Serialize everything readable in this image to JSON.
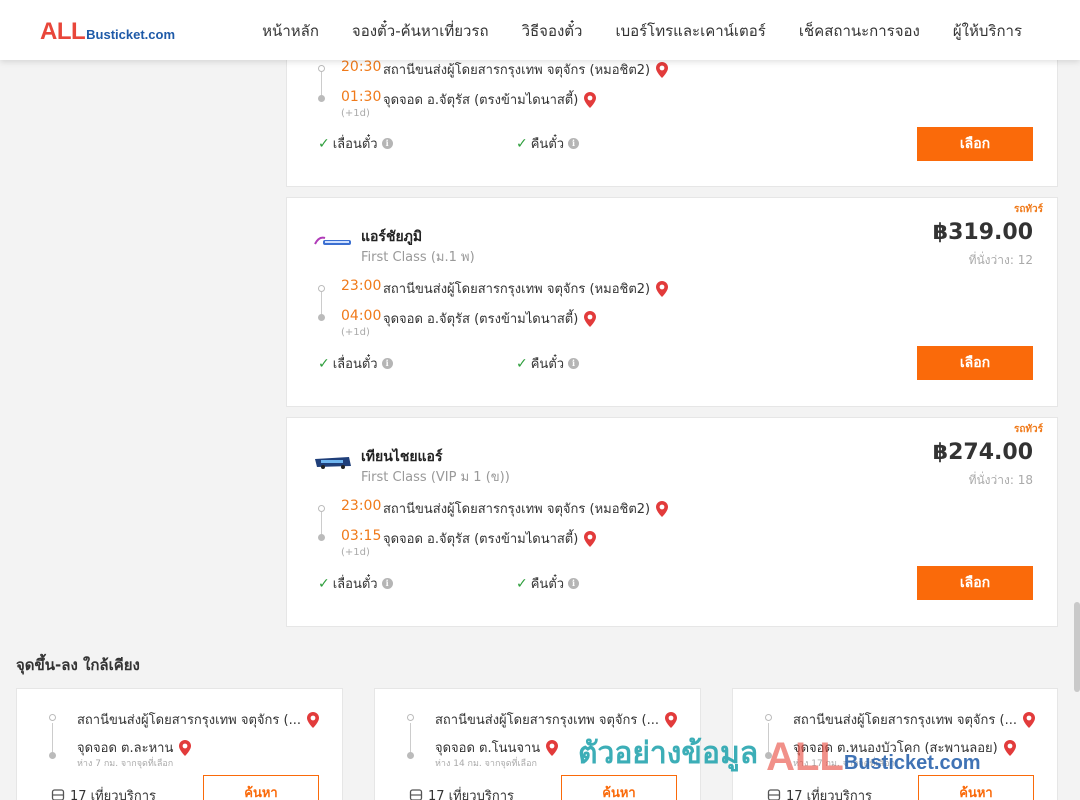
{
  "header": {
    "logo_all": "ALL",
    "logo_rest": "Busticket.com",
    "nav": [
      "หน้าหลัก",
      "จองตั๋ว-ค้นหาเที่ยวรถ",
      "วิธีจองตั๋ว",
      "เบอร์โทรและเคาน์เตอร์",
      "เช็คสถานะการจอง",
      "ผู้ให้บริการ"
    ]
  },
  "trips": [
    {
      "departure_time": "20:30",
      "departure_stop": "สถานีขนส่งผู้โดยสารกรุงเทพ จตุจักร (หมอชิต2)",
      "arrival_time": "01:30",
      "arrival_stop": "จุดจอด อ.จัตุรัส (ตรงข้ามไดนาสตี้)",
      "next_day": "(+1d)",
      "change_label": "เลื่อนตั๋ว",
      "refund_label": "คืนตั๋ว",
      "select_label": "เลือก"
    },
    {
      "tag": "รถทัวร์",
      "operator": "แอร์ชัยภูมิ",
      "class": "First Class (ม.1 พ)",
      "price": "฿319.00",
      "seats": "ที่นั่งว่าง: 12",
      "departure_time": "23:00",
      "departure_stop": "สถานีขนส่งผู้โดยสารกรุงเทพ จตุจักร (หมอชิต2)",
      "arrival_time": "04:00",
      "arrival_stop": "จุดจอด อ.จัตุรัส (ตรงข้ามไดนาสตี้)",
      "next_day": "(+1d)",
      "change_label": "เลื่อนตั๋ว",
      "refund_label": "คืนตั๋ว",
      "select_label": "เลือก"
    },
    {
      "tag": "รถทัวร์",
      "operator": "เทียนไชยแอร์",
      "class": "First Class (VIP ม 1 (ข))",
      "price": "฿274.00",
      "seats": "ที่นั่งว่าง: 18",
      "departure_time": "23:00",
      "departure_stop": "สถานีขนส่งผู้โดยสารกรุงเทพ จตุจักร (หมอชิต2)",
      "arrival_time": "03:15",
      "arrival_stop": "จุดจอด อ.จัตุรัส (ตรงข้ามไดนาสตี้)",
      "next_day": "(+1d)",
      "change_label": "เลื่อนตั๋ว",
      "refund_label": "คืนตั๋ว",
      "select_label": "เลือก"
    }
  ],
  "nearby": {
    "title": "จุดขึ้น-ลง ใกล้เคียง",
    "items": [
      {
        "from": "สถานีขนส่งผู้โดยสารกรุงเทพ จตุจักร (...",
        "to": "จุดจอด ต.ละหาน",
        "distance": "ห่าง 7 กม. จากจุดที่เลือก",
        "trips": "17 เที่ยวบริการ",
        "search_label": "ค้นหา"
      },
      {
        "from": "สถานีขนส่งผู้โดยสารกรุงเทพ จตุจักร (...",
        "to": "จุดจอด ต.โนนจาน",
        "distance": "ห่าง 14 กม. จากจุดที่เลือก",
        "trips": "17 เที่ยวบริการ",
        "search_label": "ค้นหา"
      },
      {
        "from": "สถานีขนส่งผู้โดยสารกรุงเทพ จตุจักร (...",
        "to": "จุดจอด ต.หนองบัวโคก (สะพานลอย)",
        "distance": "ห่าง 17 กม. จากจุดที่เลือก",
        "trips": "17 เที่ยวบริการ",
        "search_label": "ค้นหา"
      }
    ]
  },
  "watermark": {
    "text": "ตัวอย่างข้อมูล",
    "all": "ALL",
    "rest": "Busticket.com"
  },
  "colors": {
    "accent": "#fa6a0a",
    "time": "#f07a1a",
    "check": "#2e9e3c",
    "pin": "#e23b3b"
  }
}
